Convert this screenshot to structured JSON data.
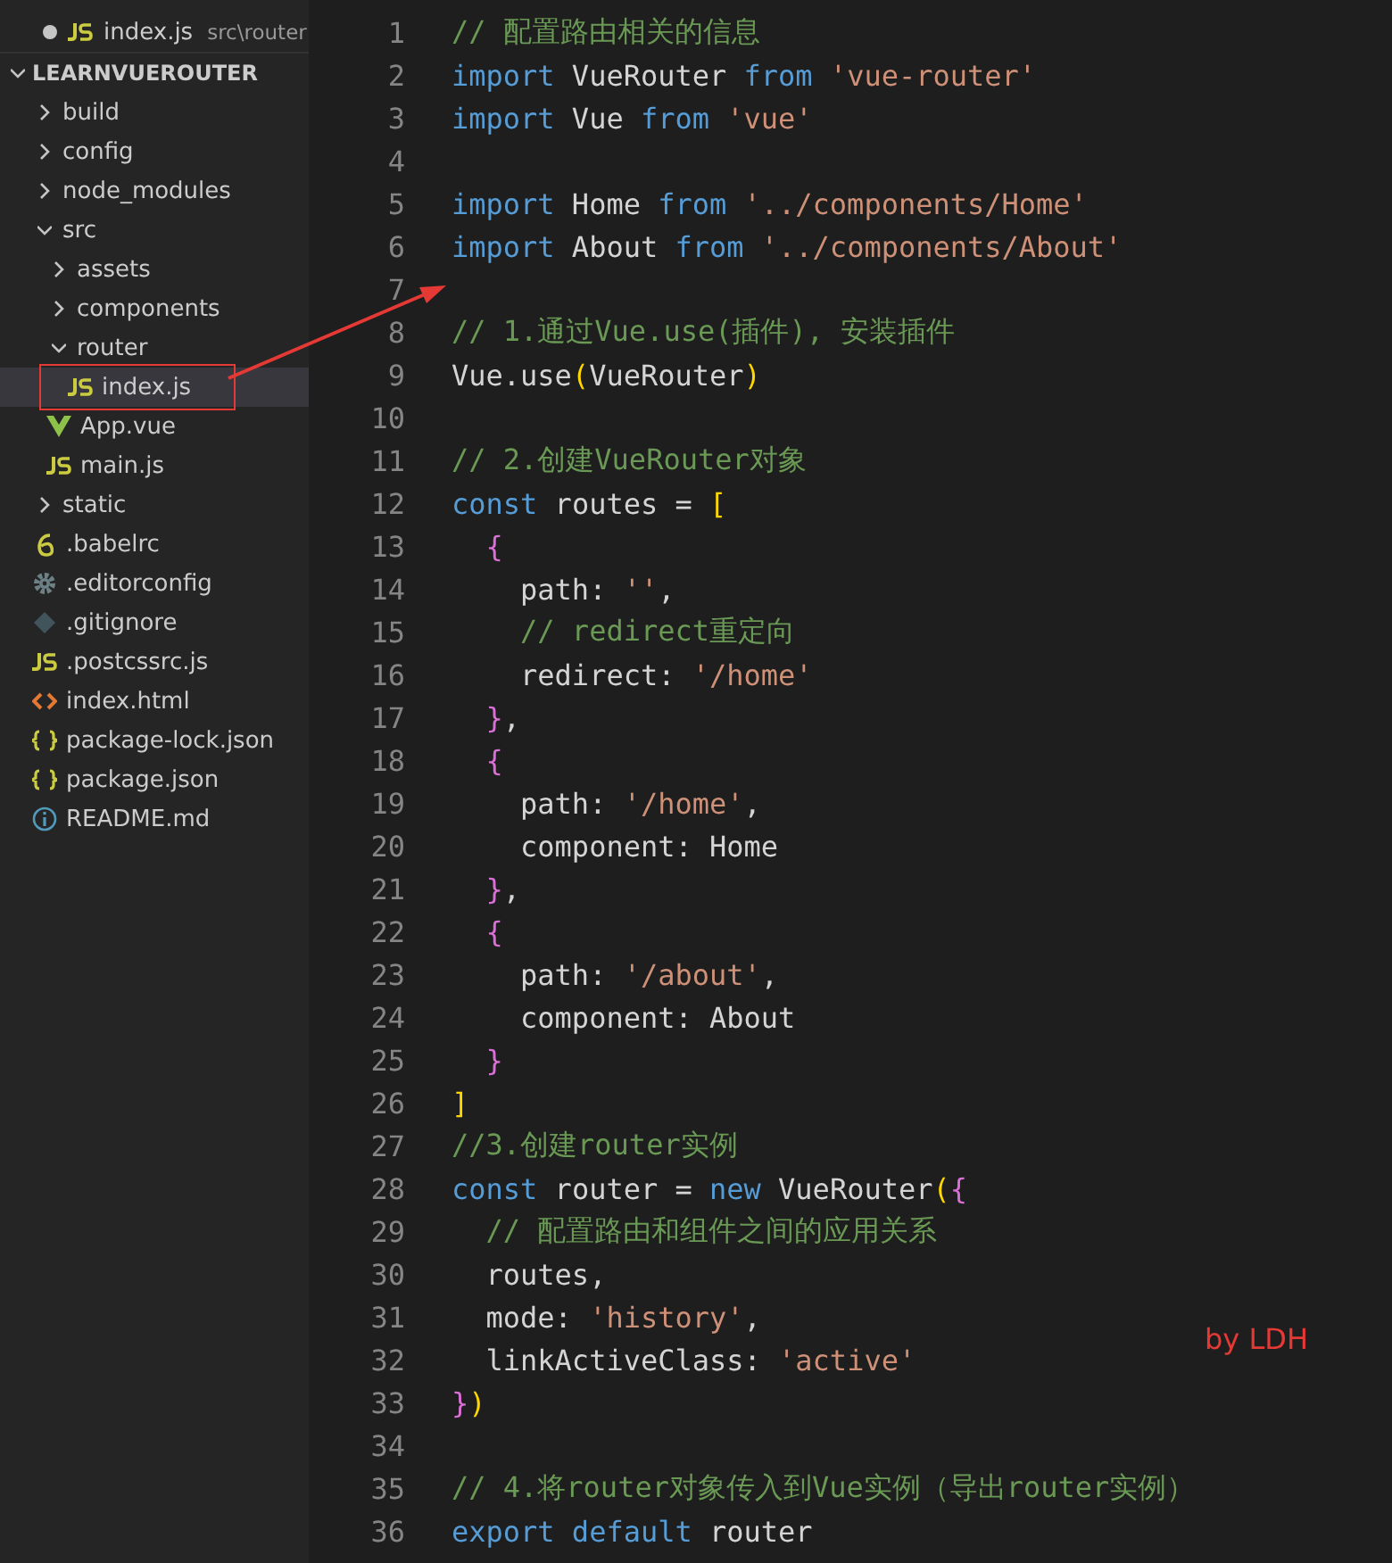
{
  "open_editors": [
    {
      "name": "index.js",
      "path": "src\\router",
      "kind": "js",
      "modified": true
    }
  ],
  "explorer": {
    "title": "LEARNVUEROUTER",
    "expanded": true,
    "items": [
      {
        "name": "build",
        "kind": "folder",
        "expanded": false,
        "selected": false
      },
      {
        "name": "config",
        "kind": "folder",
        "expanded": false,
        "selected": false
      },
      {
        "name": "node_modules",
        "kind": "folder",
        "expanded": false,
        "selected": false
      },
      {
        "name": "src",
        "kind": "folder",
        "expanded": true,
        "selected": false,
        "children": [
          {
            "name": "assets",
            "kind": "folder",
            "expanded": false,
            "selected": false
          },
          {
            "name": "components",
            "kind": "folder",
            "expanded": false,
            "selected": false
          },
          {
            "name": "router",
            "kind": "folder",
            "expanded": true,
            "selected": false,
            "children": [
              {
                "name": "index.js",
                "kind": "js",
                "selected": true
              }
            ]
          },
          {
            "name": "App.vue",
            "kind": "vue",
            "selected": false
          },
          {
            "name": "main.js",
            "kind": "js",
            "selected": false
          }
        ]
      },
      {
        "name": "static",
        "kind": "folder",
        "expanded": false,
        "selected": false
      },
      {
        "name": ".babelrc",
        "kind": "babel",
        "selected": false
      },
      {
        "name": ".editorconfig",
        "kind": "config",
        "selected": false
      },
      {
        "name": ".gitignore",
        "kind": "git",
        "selected": false
      },
      {
        "name": ".postcssrc.js",
        "kind": "js",
        "selected": false
      },
      {
        "name": "index.html",
        "kind": "html",
        "selected": false
      },
      {
        "name": "package-lock.json",
        "kind": "json",
        "selected": false
      },
      {
        "name": "package.json",
        "kind": "json",
        "selected": false
      },
      {
        "name": "README.md",
        "kind": "info",
        "selected": false
      }
    ]
  },
  "editor": {
    "lines": [
      {
        "number": "1",
        "tokens": [
          {
            "kind": "comment",
            "text": "// 配置路由相关的信息"
          }
        ]
      },
      {
        "number": "2",
        "tokens": [
          {
            "kind": "keyword",
            "text": "import"
          },
          {
            "kind": "plain",
            "text": " VueRouter "
          },
          {
            "kind": "keyword",
            "text": "from"
          },
          {
            "kind": "string",
            "text": " 'vue-router'"
          }
        ]
      },
      {
        "number": "3",
        "tokens": [
          {
            "kind": "keyword",
            "text": "import"
          },
          {
            "kind": "plain",
            "text": " Vue "
          },
          {
            "kind": "keyword",
            "text": "from"
          },
          {
            "kind": "string",
            "text": " 'vue'"
          }
        ]
      },
      {
        "number": "4"
      },
      {
        "number": "5",
        "tokens": [
          {
            "kind": "keyword",
            "text": "import"
          },
          {
            "kind": "plain",
            "text": " Home "
          },
          {
            "kind": "keyword",
            "text": "from"
          },
          {
            "kind": "string",
            "text": " '../components/Home'"
          }
        ]
      },
      {
        "number": "6",
        "tokens": [
          {
            "kind": "keyword",
            "text": "import"
          },
          {
            "kind": "plain",
            "text": " About "
          },
          {
            "kind": "keyword",
            "text": "from"
          },
          {
            "kind": "string",
            "text": " '../components/About'"
          }
        ]
      },
      {
        "number": "7"
      },
      {
        "number": "8",
        "tokens": [
          {
            "kind": "comment",
            "text": "// 1.通过Vue.use(插件), 安装插件"
          }
        ]
      },
      {
        "number": "9",
        "tokens": [
          {
            "kind": "plain",
            "text": "Vue.use"
          },
          {
            "kind": "bracket1",
            "text": "("
          },
          {
            "kind": "plain",
            "text": "VueRouter"
          },
          {
            "kind": "bracket1",
            "text": ")"
          }
        ]
      },
      {
        "number": "10"
      },
      {
        "number": "11",
        "tokens": [
          {
            "kind": "comment",
            "text": "// 2.创建VueRouter对象"
          }
        ]
      },
      {
        "number": "12",
        "tokens": [
          {
            "kind": "keyword",
            "text": "const"
          },
          {
            "kind": "plain",
            "text": " routes = "
          },
          {
            "kind": "bracket1",
            "text": "["
          }
        ]
      },
      {
        "number": "13",
        "tokens": [
          {
            "kind": "bracket2",
            "text": "  {"
          }
        ]
      },
      {
        "number": "14",
        "tokens": [
          {
            "kind": "plain",
            "text": "    path: "
          },
          {
            "kind": "string",
            "text": "''"
          },
          {
            "kind": "plain",
            "text": ","
          }
        ]
      },
      {
        "number": "15",
        "tokens": [
          {
            "kind": "comment",
            "text": "    // redirect重定向"
          }
        ]
      },
      {
        "number": "16",
        "tokens": [
          {
            "kind": "plain",
            "text": "    redirect: "
          },
          {
            "kind": "string",
            "text": "'/home'"
          }
        ]
      },
      {
        "number": "17",
        "tokens": [
          {
            "kind": "bracket2",
            "text": "  }"
          },
          {
            "kind": "plain",
            "text": ","
          }
        ]
      },
      {
        "number": "18",
        "tokens": [
          {
            "kind": "bracket2",
            "text": "  {"
          }
        ]
      },
      {
        "number": "19",
        "tokens": [
          {
            "kind": "plain",
            "text": "    path: "
          },
          {
            "kind": "string",
            "text": "'/home'"
          },
          {
            "kind": "plain",
            "text": ","
          }
        ]
      },
      {
        "number": "20",
        "tokens": [
          {
            "kind": "plain",
            "text": "    component: Home"
          }
        ]
      },
      {
        "number": "21",
        "tokens": [
          {
            "kind": "bracket2",
            "text": "  }"
          },
          {
            "kind": "plain",
            "text": ","
          }
        ]
      },
      {
        "number": "22",
        "tokens": [
          {
            "kind": "bracket2",
            "text": "  {"
          }
        ]
      },
      {
        "number": "23",
        "tokens": [
          {
            "kind": "plain",
            "text": "    path: "
          },
          {
            "kind": "string",
            "text": "'/about'"
          },
          {
            "kind": "plain",
            "text": ","
          }
        ]
      },
      {
        "number": "24",
        "tokens": [
          {
            "kind": "plain",
            "text": "    component: About"
          }
        ]
      },
      {
        "number": "25",
        "tokens": [
          {
            "kind": "bracket2",
            "text": "  }"
          }
        ]
      },
      {
        "number": "26",
        "tokens": [
          {
            "kind": "bracket1",
            "text": "]"
          }
        ]
      },
      {
        "number": "27",
        "tokens": [
          {
            "kind": "comment",
            "text": "//3.创建router实例"
          }
        ]
      },
      {
        "number": "28",
        "tokens": [
          {
            "kind": "keyword",
            "text": "const"
          },
          {
            "kind": "plain",
            "text": " router = "
          },
          {
            "kind": "keyword",
            "text": "new"
          },
          {
            "kind": "plain",
            "text": " VueRouter"
          },
          {
            "kind": "bracket1",
            "text": "("
          },
          {
            "kind": "bracket2",
            "text": "{"
          }
        ]
      },
      {
        "number": "29",
        "tokens": [
          {
            "kind": "comment",
            "text": "  // 配置路由和组件之间的应用关系"
          }
        ]
      },
      {
        "number": "30",
        "tokens": [
          {
            "kind": "plain",
            "text": "  routes,"
          }
        ]
      },
      {
        "number": "31",
        "tokens": [
          {
            "kind": "plain",
            "text": "  mode: "
          },
          {
            "kind": "string",
            "text": "'history'"
          },
          {
            "kind": "plain",
            "text": ","
          }
        ]
      },
      {
        "number": "32",
        "tokens": [
          {
            "kind": "plain",
            "text": "  linkActiveClass: "
          },
          {
            "kind": "string",
            "text": "'active'"
          }
        ]
      },
      {
        "number": "33",
        "tokens": [
          {
            "kind": "bracket2",
            "text": "}"
          },
          {
            "kind": "bracket1",
            "text": ")"
          }
        ]
      },
      {
        "number": "34"
      },
      {
        "number": "35",
        "tokens": [
          {
            "kind": "comment",
            "text": "// 4.将router对象传入到Vue实例（导出router实例）"
          }
        ]
      },
      {
        "number": "36",
        "tokens": [
          {
            "kind": "keyword",
            "text": "export default"
          },
          {
            "kind": "plain",
            "text": " router"
          }
        ]
      }
    ]
  },
  "annotations": {
    "signature": "by LDH"
  }
}
